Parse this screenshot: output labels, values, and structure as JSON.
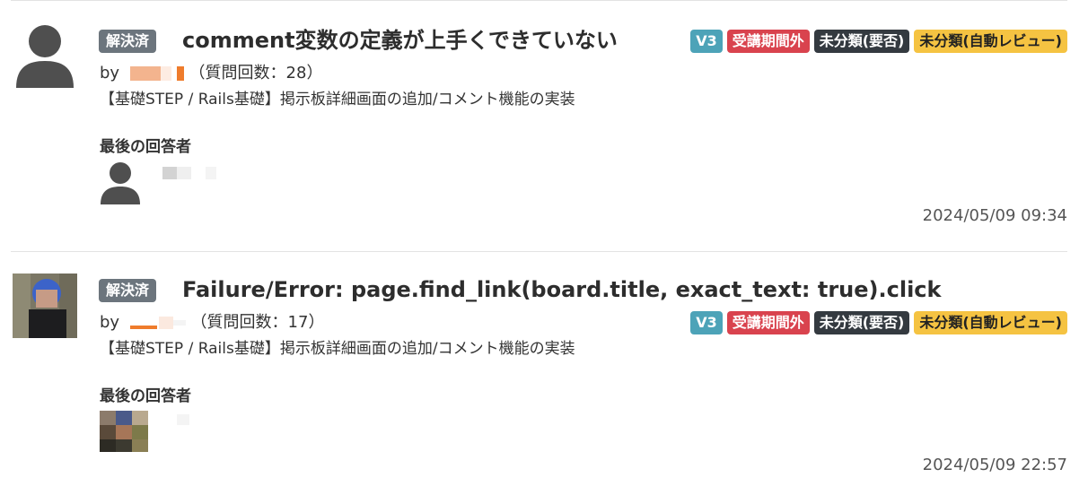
{
  "posts": [
    {
      "status": "解決済",
      "title": "comment変数の定義が上手くできていない",
      "by_prefix": "by",
      "question_count": "（質問回数：28）",
      "course": "【基礎STEP / Rails基礎】掲示板詳細画面の追加/コメント機能の実装",
      "last_answerer_label": "最後の回答者",
      "date": "2024/05/09 09:34",
      "tags": [
        "V3",
        "受講期間外",
        "未分類(要否)",
        "未分類(自動レビュー)"
      ]
    },
    {
      "status": "解決済",
      "title": "Failure/Error: page.find_link(board.title, exact_text: true).click",
      "by_prefix": "by",
      "question_count": "（質問回数：17）",
      "course": "【基礎STEP / Rails基礎】掲示板詳細画面の追加/コメント機能の実装",
      "last_answerer_label": "最後の回答者",
      "date": "2024/05/09 22:57",
      "tags": [
        "V3",
        "受講期間外",
        "未分類(要否)",
        "未分類(自動レビュー)"
      ]
    }
  ],
  "colors": {
    "tag_v3": "#4da3b8",
    "tag_period": "#d9434e",
    "tag_uncat": "#343a40",
    "tag_auto": "#f5c342"
  }
}
